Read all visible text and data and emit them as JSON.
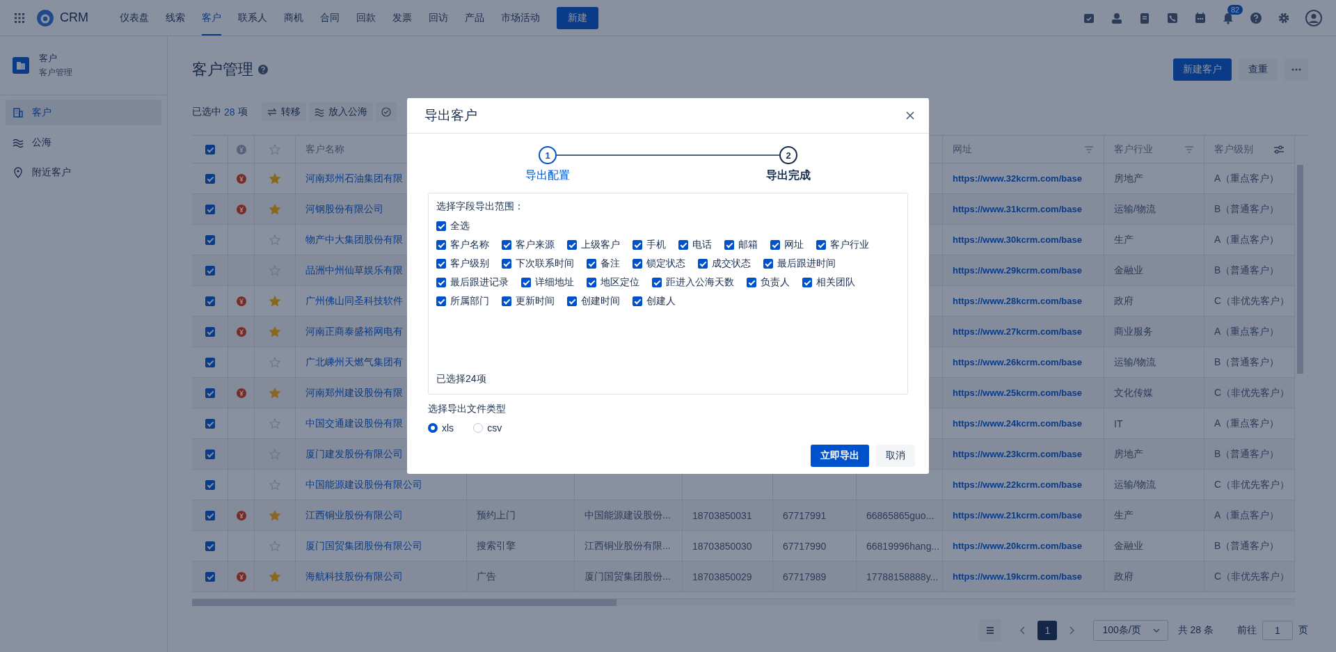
{
  "nav": {
    "logo": "CRM",
    "items": [
      {
        "label": "仪表盘",
        "selected": false
      },
      {
        "label": "线索",
        "selected": false
      },
      {
        "label": "客户",
        "selected": true
      },
      {
        "label": "联系人",
        "selected": false
      },
      {
        "label": "商机",
        "selected": false
      },
      {
        "label": "合同",
        "selected": false
      },
      {
        "label": "回款",
        "selected": false
      },
      {
        "label": "发票",
        "selected": false
      },
      {
        "label": "回访",
        "selected": false
      },
      {
        "label": "产品",
        "selected": false
      },
      {
        "label": "市场活动",
        "selected": false
      }
    ],
    "new_button": "新建",
    "notification_count": "82"
  },
  "sidebar": {
    "title": "客户",
    "subtitle": "客户管理",
    "items": [
      {
        "label": "客户",
        "selected": true
      },
      {
        "label": "公海",
        "selected": false
      },
      {
        "label": "附近客户",
        "selected": false
      }
    ]
  },
  "page": {
    "title": "客户管理",
    "primary_button": "新建客户",
    "secondary_button": "查重"
  },
  "toolbar": {
    "selected_prefix": "已选中",
    "selected_count": "28",
    "selected_suffix": "项",
    "actions": [
      "转移",
      "放入公海"
    ]
  },
  "table": {
    "header_checked": true,
    "headers": {
      "name": "客户名称",
      "url": "网址",
      "industry": "客户行业",
      "level": "客户级别"
    },
    "rows": [
      {
        "checked": true,
        "deal": true,
        "starred": true,
        "name": "河南郑州石油集团有限",
        "url": "https://www.32kcrm.com/base",
        "industry": "房地产",
        "level": "A（重点客户）"
      },
      {
        "checked": true,
        "deal": true,
        "starred": true,
        "name": "河钢股份有限公司",
        "url": "https://www.31kcrm.com/base",
        "industry": "运输/物流",
        "level": "B（普通客户）"
      },
      {
        "checked": true,
        "deal": false,
        "starred": false,
        "name": "物产中大集团股份有限",
        "url": "https://www.30kcrm.com/base",
        "industry": "生产",
        "level": "A（重点客户）"
      },
      {
        "checked": true,
        "deal": false,
        "starred": false,
        "name": "品洲中州仙草娱乐有限",
        "url": "https://www.29kcrm.com/base",
        "industry": "金融业",
        "level": "B（普通客户）"
      },
      {
        "checked": true,
        "deal": true,
        "starred": true,
        "name": "广州佛山同圣科技软件",
        "url": "https://www.28kcrm.com/base",
        "industry": "政府",
        "level": "C（非优先客户）"
      },
      {
        "checked": true,
        "deal": true,
        "starred": true,
        "name": "河南正商泰盛裕网电有",
        "url": "https://www.27kcrm.com/base",
        "industry": "商业服务",
        "level": "A（重点客户）"
      },
      {
        "checked": true,
        "deal": false,
        "starred": false,
        "name": "广北嵊州天燃气集团有",
        "url": "https://www.26kcrm.com/base",
        "industry": "运输/物流",
        "level": "B（普通客户）"
      },
      {
        "checked": true,
        "deal": true,
        "starred": true,
        "name": "河南郑州建设股份有限",
        "url": "https://www.25kcrm.com/base",
        "industry": "文化传媒",
        "level": "C（非优先客户）"
      },
      {
        "checked": true,
        "deal": false,
        "starred": false,
        "name": "中国交通建设股份有限",
        "url": "https://www.24kcrm.com/base",
        "industry": "IT",
        "level": "A（重点客户）"
      },
      {
        "checked": true,
        "deal": false,
        "starred": false,
        "name": "厦门建发股份有限公司",
        "url": "https://www.23kcrm.com/base",
        "industry": "房地产",
        "level": "B（普通客户）"
      },
      {
        "checked": true,
        "deal": false,
        "starred": false,
        "name": "中国能源建设股份有限公司",
        "url": "https://www.22kcrm.com/base",
        "industry": "运输/物流",
        "level": "C（非优先客户）"
      },
      {
        "checked": true,
        "deal": true,
        "starred": true,
        "name": "江西铜业股份有限公司",
        "source": "预约上门",
        "parent": "中国能源建设股份...",
        "phone": "18703850031",
        "tel": "67717991",
        "email": "66865865guo...",
        "url": "https://www.21kcrm.com/base",
        "industry": "生产",
        "level": "A（重点客户）"
      },
      {
        "checked": true,
        "deal": false,
        "starred": false,
        "name": "厦门国贸集团股份有限公司",
        "source": "搜索引擎",
        "parent": "江西铜业股份有限...",
        "phone": "18703850030",
        "tel": "67717990",
        "email": "66819996hang...",
        "url": "https://www.20kcrm.com/base",
        "industry": "金融业",
        "level": "B（普通客户）"
      },
      {
        "checked": true,
        "deal": true,
        "starred": true,
        "name": "海航科技股份有限公司",
        "source": "广告",
        "parent": "厦门国贸集团股份...",
        "phone": "18703850029",
        "tel": "67717989",
        "email": "17788158888y...",
        "url": "https://www.19kcrm.com/base",
        "industry": "政府",
        "level": "C（非优先客户）"
      }
    ]
  },
  "pagination": {
    "pages": [
      {
        "label": "1",
        "selected": true
      }
    ],
    "page_size": "100条/页",
    "total": "共 28 条",
    "goto_label": "前往",
    "goto_value": "1",
    "goto_suffix": "页"
  },
  "dialog": {
    "title": "导出客户",
    "steps": [
      {
        "number": "1",
        "label": "导出配置",
        "active": true
      },
      {
        "number": "2",
        "label": "导出完成",
        "active": false
      }
    ],
    "fields_label": "选择字段导出范围：",
    "select_all": {
      "label": "全选",
      "checked": true
    },
    "field_rows": [
      [
        {
          "label": "客户名称",
          "checked": true
        },
        {
          "label": "客户来源",
          "checked": true
        },
        {
          "label": "上级客户",
          "checked": true
        },
        {
          "label": "手机",
          "checked": true
        },
        {
          "label": "电话",
          "checked": true
        },
        {
          "label": "邮箱",
          "checked": true
        },
        {
          "label": "网址",
          "checked": true
        },
        {
          "label": "客户行业",
          "checked": true
        }
      ],
      [
        {
          "label": "客户级别",
          "checked": true
        },
        {
          "label": "下次联系时间",
          "checked": true
        },
        {
          "label": "备注",
          "checked": true
        },
        {
          "label": "锁定状态",
          "checked": true
        },
        {
          "label": "成交状态",
          "checked": true
        },
        {
          "label": "最后跟进时间",
          "checked": true
        }
      ],
      [
        {
          "label": "最后跟进记录",
          "checked": true
        },
        {
          "label": "详细地址",
          "checked": true
        },
        {
          "label": "地区定位",
          "checked": true
        },
        {
          "label": "距进入公海天数",
          "checked": true
        },
        {
          "label": "负责人",
          "checked": true
        },
        {
          "label": "相关团队",
          "checked": true
        }
      ],
      [
        {
          "label": "所属部门",
          "checked": true
        },
        {
          "label": "更新时间",
          "checked": true
        },
        {
          "label": "创建时间",
          "checked": true
        },
        {
          "label": "创建人",
          "checked": true
        }
      ]
    ],
    "selected_count": "已选择24项",
    "file_type_label": "选择导出文件类型",
    "file_types": [
      {
        "label": "xls",
        "selected": true
      },
      {
        "label": "csv",
        "selected": false
      }
    ],
    "confirm_button": "立即导出",
    "cancel_button": "取消"
  }
}
